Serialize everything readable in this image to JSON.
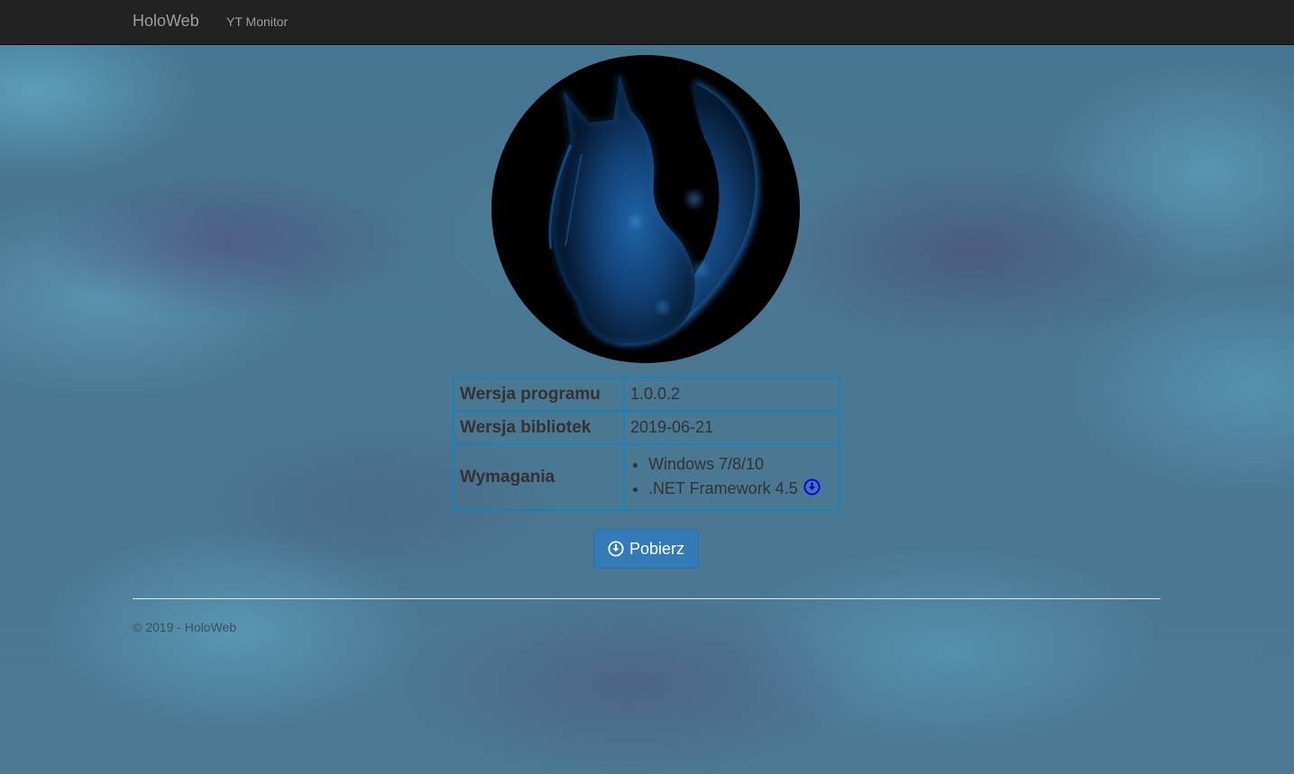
{
  "navbar": {
    "brand": "HoloWeb",
    "links": [
      {
        "label": "YT Monitor"
      }
    ]
  },
  "logo": {
    "icon": "holo-wolf-logo"
  },
  "info": {
    "version_label": "Wersja programu",
    "version_value": "1.0.0.2",
    "libs_label": "Wersja bibliotek",
    "libs_value": "2019-06-21",
    "req_label": "Wymagania",
    "requirements": [
      "Windows 7/8/10",
      ".NET Framework 4.5"
    ],
    "req_download_icon": "download-circle-icon"
  },
  "button": {
    "label": "Pobierz",
    "icon": "download-circle-icon"
  },
  "footer": {
    "text": "© 2019 - HoloWeb"
  },
  "colors": {
    "navbar": "#222222",
    "button": "#337ab7",
    "table_border": "#1b80b8",
    "link_icon": "#0000ff"
  }
}
